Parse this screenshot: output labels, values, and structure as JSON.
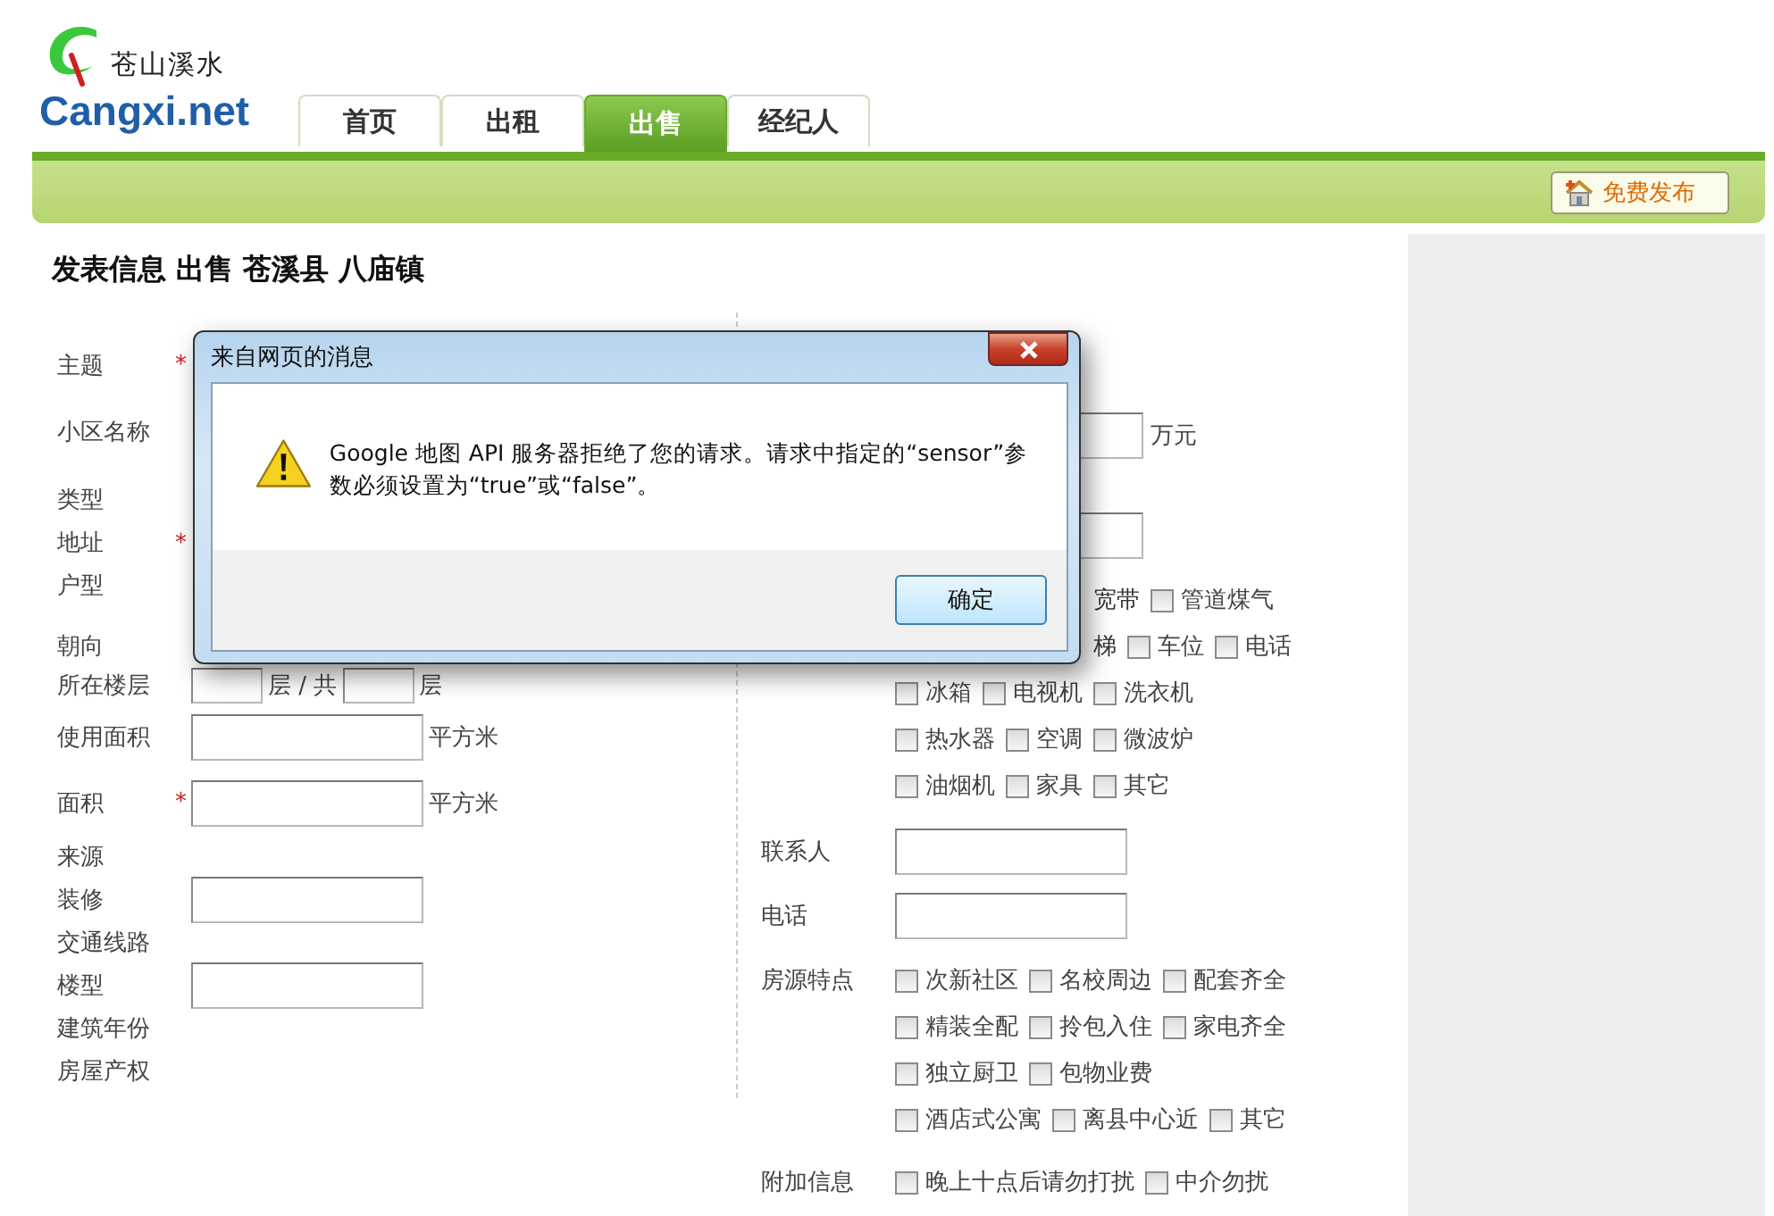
{
  "logo": {
    "tagline": "苍山溪水",
    "name": "Cangxi.net"
  },
  "tabs": [
    {
      "label": "首页",
      "selected": false
    },
    {
      "label": "出租",
      "selected": false
    },
    {
      "label": "出售",
      "selected": true
    },
    {
      "label": "经纪人",
      "selected": false
    }
  ],
  "publish_button": "免费发布",
  "page_title": "发表信息 出售 苍溪县 八庙镇",
  "left_rows": [
    {
      "label": "主题",
      "kind": "tall",
      "marker": "*"
    },
    {
      "label": "小区名称",
      "kind": "tall"
    },
    {
      "label": "类型",
      "kind": "text"
    },
    {
      "label": "地址",
      "kind": "text",
      "marker": "*"
    },
    {
      "label": "户型",
      "kind": "text"
    },
    {
      "label": "朝向",
      "kind": "text"
    },
    {
      "label": "所在楼层",
      "kind": "floor",
      "between": "层 / 共",
      "after": "层"
    },
    {
      "label": "使用面积",
      "kind": "field",
      "unit": "平方米"
    },
    {
      "label": "面积",
      "kind": "field",
      "marker": "*",
      "unit": "平方米"
    },
    {
      "label": "来源",
      "kind": "text"
    },
    {
      "label": "装修",
      "kind": "inline_field"
    },
    {
      "label": "交通线路",
      "kind": "text"
    },
    {
      "label": "楼型",
      "kind": "inline_field"
    },
    {
      "label": "建筑年份",
      "kind": "text"
    },
    {
      "label": "房屋产权",
      "kind": "text"
    }
  ],
  "right_rows": [
    {
      "kind": "cut_field",
      "unit": "万元"
    },
    {
      "kind": "cut_field"
    },
    {
      "kind": "checks",
      "cut_label": "宽带",
      "items": [
        {
          "label": "管道煤气",
          "checked": false
        }
      ]
    },
    {
      "kind": "checks",
      "cut_label": "梯",
      "items": [
        {
          "label": "车位",
          "checked": false
        },
        {
          "label": "电话",
          "checked": false
        }
      ]
    },
    {
      "kind": "checks",
      "items": [
        {
          "label": "冰箱",
          "checked": false
        },
        {
          "label": "电视机",
          "checked": false
        },
        {
          "label": "洗衣机",
          "checked": false
        }
      ]
    },
    {
      "kind": "checks",
      "items": [
        {
          "label": "热水器",
          "checked": false
        },
        {
          "label": "空调",
          "checked": false
        },
        {
          "label": "微波炉",
          "checked": false
        }
      ]
    },
    {
      "kind": "checks",
      "items": [
        {
          "label": "油烟机",
          "checked": false
        },
        {
          "label": "家具",
          "checked": false
        },
        {
          "label": "其它",
          "checked": false
        }
      ]
    },
    {
      "kind": "field",
      "label": "联系人"
    },
    {
      "kind": "field",
      "label": "电话"
    },
    {
      "kind": "checks",
      "label": "房源特点",
      "items": [
        {
          "label": "次新社区",
          "checked": false
        },
        {
          "label": "名校周边",
          "checked": false
        },
        {
          "label": "配套齐全",
          "checked": false
        }
      ]
    },
    {
      "kind": "checks",
      "items": [
        {
          "label": "精装全配",
          "checked": false
        },
        {
          "label": "拎包入住",
          "checked": false
        },
        {
          "label": "家电齐全",
          "checked": false
        }
      ]
    },
    {
      "kind": "checks",
      "items": [
        {
          "label": "独立厨卫",
          "checked": false
        },
        {
          "label": "包物业费",
          "checked": false
        }
      ]
    },
    {
      "kind": "checks",
      "items": [
        {
          "label": "酒店式公寓",
          "checked": false
        },
        {
          "label": "离县中心近",
          "checked": false
        },
        {
          "label": "其它",
          "checked": false
        }
      ]
    },
    {
      "kind": "checks",
      "label": "附加信息",
      "items": [
        {
          "label": "晚上十点后请勿打扰",
          "checked": false
        },
        {
          "label": "中介勿扰",
          "checked": false
        }
      ]
    }
  ],
  "dialog": {
    "title": "来自网页的消息",
    "message": "Google 地图 API 服务器拒绝了您的请求。请求中指定的“sensor”参数必须设置为“true”或“false”。",
    "ok_button": "确定"
  }
}
